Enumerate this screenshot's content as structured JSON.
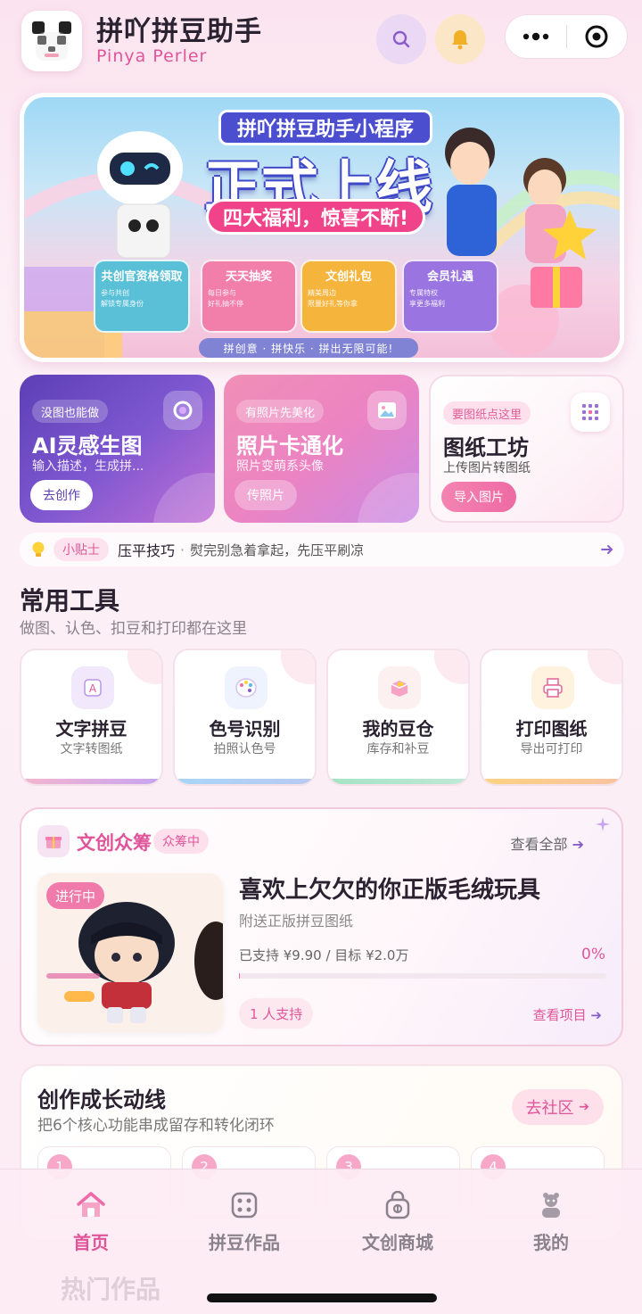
{
  "header": {
    "title": "拼吖拼豆助手",
    "subtitle": "Pinya Perler",
    "search_icon": "search-icon",
    "bell_icon": "bell-icon",
    "more_icon": "more-dots-icon",
    "close_icon": "target-icon"
  },
  "banner": {
    "line1": "拼吖拼豆助手小程序",
    "line2": "正式上线",
    "line3": "四大福利，惊喜不断!",
    "perks": [
      {
        "title": "共创官资格领取",
        "desc": "参与共创\n解锁专属身份"
      },
      {
        "title": "天天抽奖",
        "desc": "每日参与\n好礼抽不停"
      },
      {
        "title": "文创礼包",
        "desc": "精美周边\n限量好礼等你拿"
      },
      {
        "title": "会员礼遇",
        "desc": "专属特权\n享更多福利"
      }
    ],
    "footer": "拼创意 · 拼快乐 · 拼出无限可能!",
    "colors": {
      "blue": "#4a4ecf",
      "pink": "#f0438a"
    }
  },
  "features": [
    {
      "tag": "没图也能做",
      "title": "AI灵感生图",
      "desc": "输入描述，生成拼...",
      "button": "去创作"
    },
    {
      "tag": "有照片先美化",
      "title": "照片卡通化",
      "desc": "照片变萌系头像",
      "button": "传照片"
    },
    {
      "tag": "要图纸点这里",
      "title": "图纸工坊",
      "desc": "上传图片转图纸",
      "button": "导入图片"
    }
  ],
  "tips": {
    "label": "小贴士",
    "head": "压平技巧",
    "text": "熨完别急着拿起，先压平刷凉"
  },
  "tools": {
    "title": "常用工具",
    "subtitle": "做图、认色、扣豆和打印都在这里",
    "items": [
      {
        "name": "文字拼豆",
        "desc": "文字转图纸",
        "icon": "text-icon"
      },
      {
        "name": "色号识别",
        "desc": "拍照认色号",
        "icon": "palette-icon"
      },
      {
        "name": "我的豆仓",
        "desc": "库存和补豆",
        "icon": "box-icon"
      },
      {
        "name": "打印图纸",
        "desc": "导出可打印",
        "icon": "printer-icon"
      }
    ]
  },
  "crowdfund": {
    "title": "文创众筹",
    "badge": "众筹中",
    "view_all": "查看全部",
    "status": "进行中",
    "name": "喜欢上欠欠的你正版毛绒玩具",
    "desc": "附送正版拼豆图纸",
    "raised": "已支持 ¥9.90 / 目标 ¥2.0万",
    "percent_text": "0%",
    "progress": 0.0005,
    "supporters": "1 人支持",
    "view_project": "查看项目"
  },
  "growth": {
    "title": "创作成长动线",
    "subtitle": "把6个核心功能串成留存和转化闭环",
    "button": "去社区",
    "steps": [
      "1",
      "2",
      "3",
      "4"
    ]
  },
  "tabbar": {
    "items": [
      {
        "label": "首页",
        "icon": "home-icon"
      },
      {
        "label": "拼豆作品",
        "icon": "dice-icon"
      },
      {
        "label": "文创商城",
        "icon": "shop-bag-icon"
      },
      {
        "label": "我的",
        "icon": "profile-icon"
      }
    ],
    "active": 0
  },
  "ghost_text": "热门作品"
}
